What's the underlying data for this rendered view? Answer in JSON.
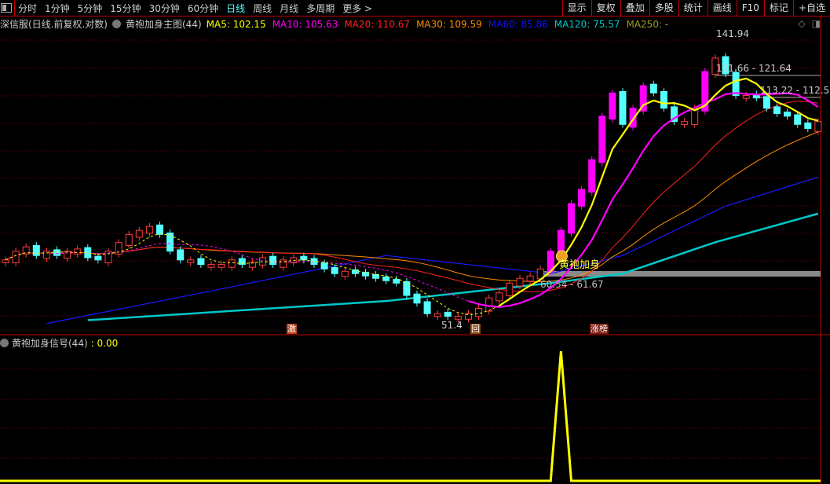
{
  "toolbar": {
    "periods": [
      "分时",
      "1分钟",
      "5分钟",
      "15分钟",
      "30分钟",
      "60分钟",
      "日线",
      "周线",
      "月线",
      "多周期",
      "更多 >"
    ],
    "active_period": "日线",
    "buttons": [
      "显示",
      "复权",
      "叠加",
      "多股",
      "统计",
      "画线",
      "F10",
      "标记",
      "+自选"
    ]
  },
  "legend": {
    "stock": "深信服(日线.前复权.对数)",
    "indicator": "黄袍加身主图(44)",
    "ma": [
      {
        "label": "MA5: 102.15",
        "color": "#ffff00"
      },
      {
        "label": "MA10: 105.63",
        "color": "#ff00ff"
      },
      {
        "label": "MA20: 110.67",
        "color": "#ff2020"
      },
      {
        "label": "MA30: 109.59",
        "color": "#ff8c00"
      },
      {
        "label": "MA60: 85.86",
        "color": "#1010ff"
      },
      {
        "label": "MA120: 75.57",
        "color": "#00c8c8"
      },
      {
        "label": "MA250: -",
        "color": "#9a9a20"
      }
    ]
  },
  "sub_legend": {
    "name": "黄袍加身信号(44)",
    "value": ": 0.00"
  },
  "annotations": {
    "high": "141.94",
    "line1": "121.66 - 121.64",
    "line2": "113.22 - 112.5",
    "band": "60.54 - 61.67",
    "low": "51.4",
    "signal_label": "黄袍加身",
    "mark_ji": "激",
    "mark_hui": "回",
    "mark_zhangbang": "涨榜"
  },
  "chart_data": {
    "type": "candlestick",
    "scale": "log",
    "ylim": [
      51.4,
      141.94
    ],
    "close": [
      64,
      66,
      67,
      65,
      66,
      65,
      66,
      66.5,
      64.5,
      64,
      66,
      68,
      70,
      71,
      72,
      70,
      66,
      64,
      64,
      63,
      63,
      63,
      64,
      63,
      63.5,
      64.5,
      63,
      64,
      64.5,
      64,
      63,
      62,
      61,
      61.5,
      61,
      60.5,
      60,
      59.5,
      59,
      56.5,
      55,
      53,
      53,
      52.5,
      52.5,
      53,
      54,
      56,
      57,
      59,
      60,
      60.5,
      62,
      66,
      71,
      78,
      82,
      91,
      106,
      115,
      103,
      109,
      118,
      115,
      109,
      104,
      104,
      109,
      124,
      130,
      123,
      114,
      114,
      113,
      109,
      107,
      106,
      103,
      101.5,
      104
    ],
    "ma60": {
      "index": [
        4,
        20,
        37,
        53,
        60,
        70,
        79
      ],
      "values": [
        51.2,
        57.4,
        65.0,
        61.0,
        65.0,
        77.3,
        85.6
      ]
    },
    "ma120": {
      "index": [
        8,
        37,
        53,
        60,
        69,
        79
      ],
      "values": [
        51.8,
        55.4,
        59.0,
        61.0,
        68.1,
        75.3
      ]
    },
    "signal": {
      "index": [
        54
      ],
      "values": [
        1
      ]
    },
    "signal_ylim": [
      0,
      1
    ]
  }
}
